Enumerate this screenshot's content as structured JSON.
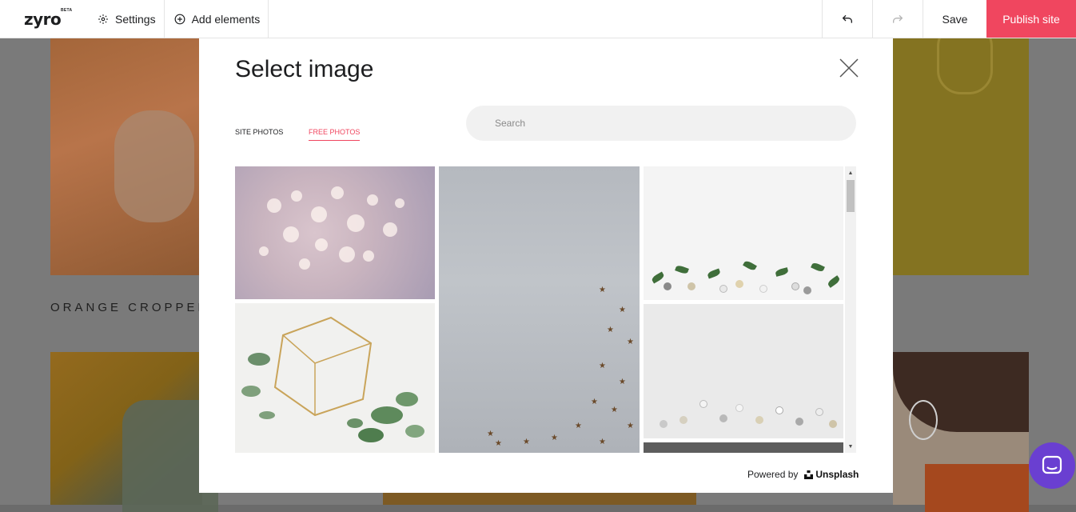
{
  "topbar": {
    "logo": "zyro",
    "beta": "BETA",
    "settings_label": "Settings",
    "add_elements_label": "Add elements",
    "save_label": "Save",
    "publish_label": "Publish site",
    "publish_color": "#f0465f"
  },
  "background": {
    "caption": "ORANGE CROPPED"
  },
  "modal": {
    "title": "Select image",
    "tabs": [
      {
        "label": "SITE PHOTOS",
        "active": false
      },
      {
        "label": "FREE PHOTOS",
        "active": true
      }
    ],
    "search": {
      "placeholder": "Search",
      "value": ""
    },
    "photos": [
      {
        "name": "pink bokeh lights"
      },
      {
        "name": "gold geometric frame with eucalyptus"
      },
      {
        "name": "grey concrete with gold stars"
      },
      {
        "name": "christmas baubles with leaves"
      },
      {
        "name": "silver and white ornaments on white"
      },
      {
        "name": "dark grey texture"
      }
    ],
    "powered_by": "Powered by",
    "provider": "Unsplash"
  },
  "icons": [
    "gear-icon",
    "plus-circle-icon",
    "undo-icon",
    "redo-icon",
    "close-icon",
    "unsplash-icon",
    "chat-icon"
  ]
}
